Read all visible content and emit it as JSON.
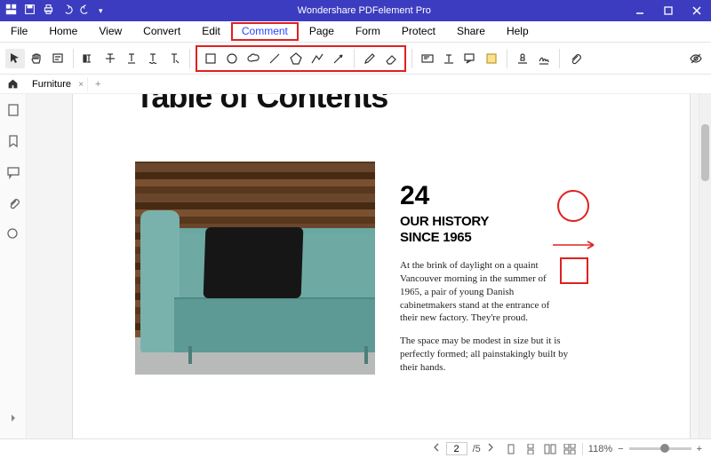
{
  "app_title": "Wondershare PDFelement Pro",
  "menus": {
    "file": "File",
    "home": "Home",
    "view": "View",
    "convert": "Convert",
    "edit": "Edit",
    "comment": "Comment",
    "page": "Page",
    "form": "Form",
    "protect": "Protect",
    "share": "Share",
    "help": "Help"
  },
  "tab": {
    "name": "Furniture",
    "close": "×",
    "add": "+"
  },
  "doc": {
    "toc": "Table of Contents",
    "num": "24",
    "h1": "OUR HISTORY",
    "h2": "SINCE 1965",
    "p1": "At the brink of daylight on a quaint Vancouver morning in the summer of 1965, a pair of young Danish cabinetmakers stand at the entrance of their new factory. They're proud.",
    "p2": "The space may be modest in size but it is perfectly formed; all painstakingly built by their hands."
  },
  "status": {
    "page_current": "2",
    "page_sep": "/5",
    "zoom": "118%",
    "minus": "−",
    "plus": "+"
  }
}
